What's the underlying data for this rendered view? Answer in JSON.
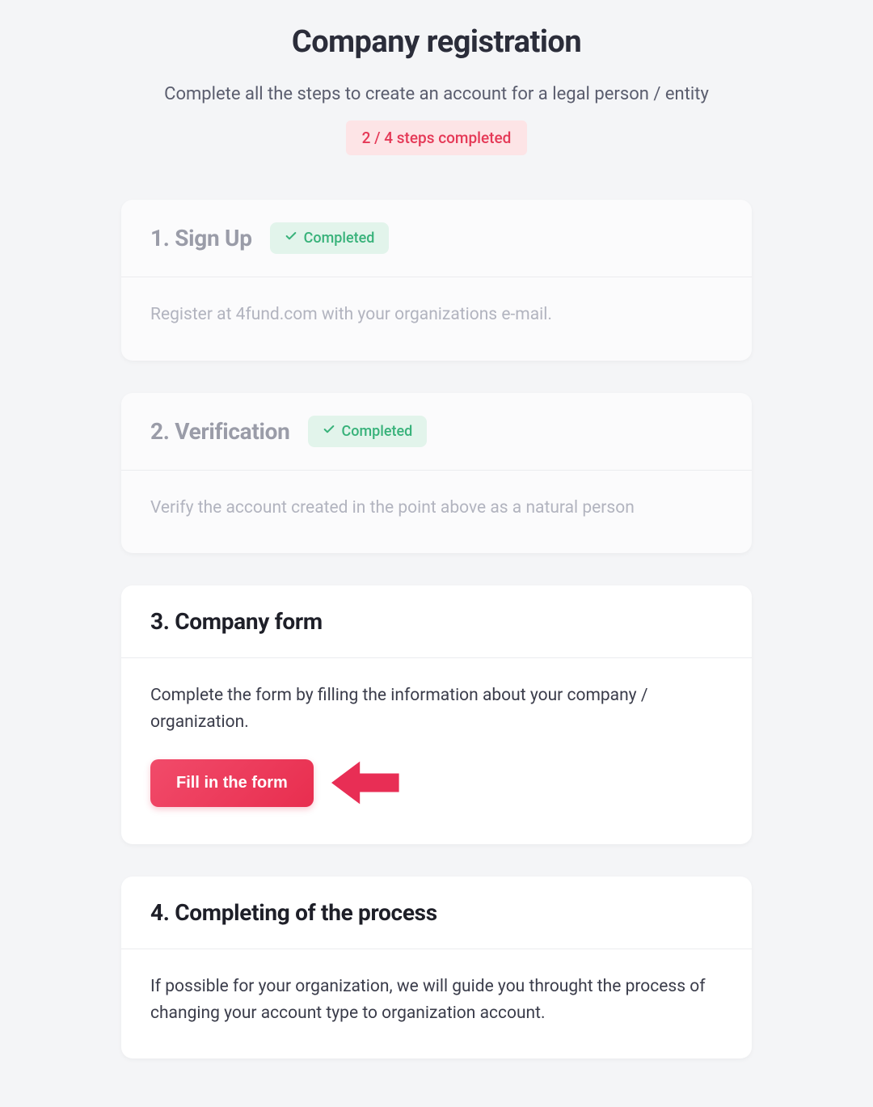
{
  "header": {
    "title": "Company registration",
    "subtitle": "Complete all the steps to create an account for a legal person / entity",
    "progress_text": "2 / 4 steps completed"
  },
  "steps": [
    {
      "title": "1. Sign Up",
      "completed_label": "Completed",
      "description": "Register at 4fund.com with your organizations e-mail."
    },
    {
      "title": "2. Verification",
      "completed_label": "Completed",
      "description": "Verify the account created in the point above as a natural person"
    },
    {
      "title": "3. Company form",
      "description": "Complete the form by filling the information about your company / organization.",
      "button_label": "Fill in the form"
    },
    {
      "title": "4. Completing of the process",
      "description": "If possible for your organization, we will guide you throught the process of changing your account type to organization account."
    }
  ],
  "colors": {
    "accent": "#e82e4f",
    "success": "#38b27a"
  }
}
